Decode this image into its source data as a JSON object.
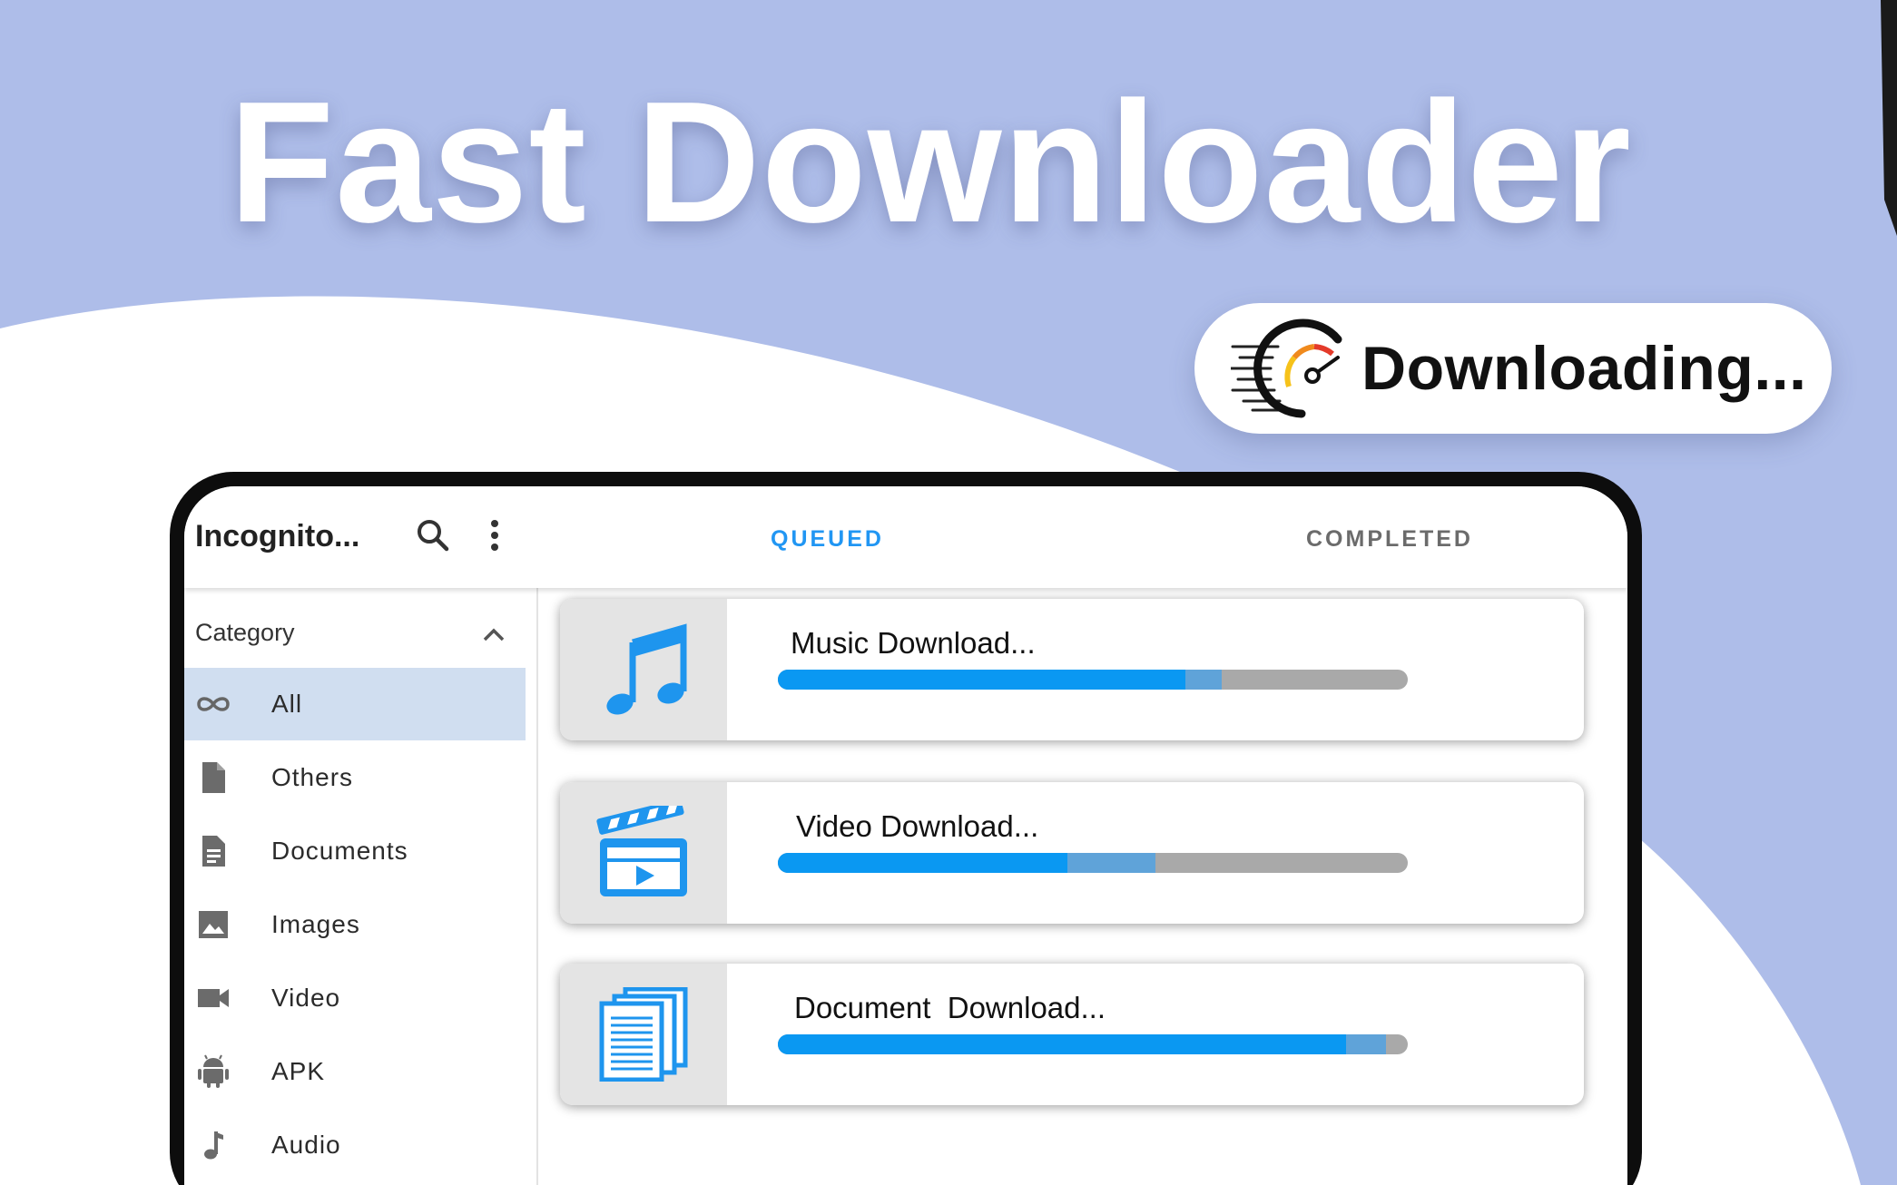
{
  "hero": {
    "title": "Fast Downloader"
  },
  "status_pill": {
    "text": "Downloading...",
    "icon": "speedometer-icon"
  },
  "colors": {
    "background": "#aebde9",
    "accent_blue": "#2196f3",
    "progress": "#0a98f2",
    "buffer": "#5fa3d9",
    "track": "#a9a9a9",
    "active_row": "#d0def0"
  },
  "app": {
    "title": "Incognito...",
    "search_icon": "search-icon",
    "menu_icon": "more-vert-icon"
  },
  "tabs": [
    {
      "label": "QUEUED",
      "active": true
    },
    {
      "label": "COMPLETED",
      "active": false
    }
  ],
  "sidebar": {
    "header": "Category",
    "expanded": true,
    "items": [
      {
        "label": "All",
        "icon": "infinity-icon",
        "active": true
      },
      {
        "label": "Others",
        "icon": "file-icon",
        "active": false
      },
      {
        "label": "Documents",
        "icon": "document-icon",
        "active": false
      },
      {
        "label": "Images",
        "icon": "image-icon",
        "active": false
      },
      {
        "label": "Video",
        "icon": "videocam-icon",
        "active": false
      },
      {
        "label": "APK",
        "icon": "android-icon",
        "active": false
      },
      {
        "label": "Audio",
        "icon": "music-note-icon",
        "active": false
      }
    ]
  },
  "downloads": [
    {
      "name": "Music Download...",
      "icon": "music-icon",
      "progress": 0.647,
      "buffered": 0.705
    },
    {
      "name": "Video Download...",
      "icon": "clapperboard-icon",
      "progress": 0.46,
      "buffered": 0.6
    },
    {
      "name": "Document  Download...",
      "icon": "documents-stack-icon",
      "progress": 0.902,
      "buffered": 0.965
    }
  ]
}
